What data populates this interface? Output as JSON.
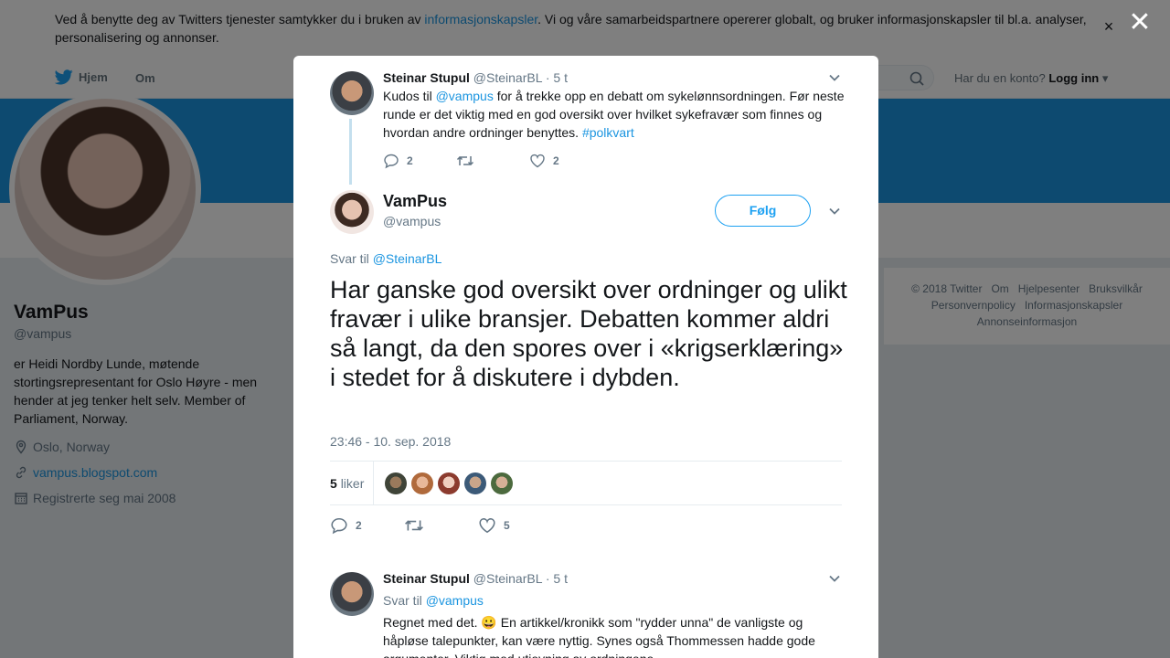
{
  "cookie": {
    "text_before": "Ved å benytte deg av Twitters tjenester samtykker du i bruken av ",
    "link": "informasjonskapsler",
    "text_after": ". Vi og våre samarbeidspartnere opererer globalt, og bruker informasjonskapsler til bl.a. analyser, personalisering og annonser.",
    "close": "×"
  },
  "nav": {
    "home": "Hjem",
    "about": "Om",
    "login_prompt": "Har du en konto?",
    "login": "Logg inn"
  },
  "profile": {
    "name": "VamPus",
    "handle": "@vampus",
    "bio": "er Heidi Nordby Lunde, møtende stortingsrepresentant for Oslo Høyre - men hender at jeg tenker helt selv. Member of Parliament, Norway.",
    "location": "Oslo, Norway",
    "website": "vampus.blogspot.com",
    "joined": "Registrerte seg mai 2008"
  },
  "footer": [
    "© 2018 Twitter",
    "Om",
    "Hjelpesenter",
    "Bruksvilkår",
    "Personvernpolicy",
    "Informasjonskapsler",
    "Annonseinformasjon"
  ],
  "overlay_close": "✕",
  "parent_tweet": {
    "name": "Steinar Stupul",
    "handle": "@SteinarBL",
    "time": "· 5 t",
    "text_1": "Kudos til ",
    "mention": "@vampus",
    "text_2": " for å trekke opp en debatt om sykelønnsordningen. Før neste runde er det viktig med en god oversikt over hvilket sykefravær som finnes og hvordan andre ordninger benyttes. ",
    "hashtag": "#polkvart",
    "replies": "2",
    "likes": "2"
  },
  "main_tweet": {
    "name": "VamPus",
    "handle": "@vampus",
    "follow": "Følg",
    "reply_prefix": "Svar til ",
    "reply_to": "@SteinarBL",
    "text": "Har ganske god oversikt over ordninger og ulikt fravær i ulike bransjer. Debatten kommer aldri så langt, da den spores over i «krigserklæring» i stedet for å diskutere i dybden.",
    "timestamp": "23:46 - 10. sep. 2018",
    "likes_count": "5",
    "likes_label": "liker",
    "replies": "2",
    "likes": "5"
  },
  "reply_tweet": {
    "name": "Steinar Stupul",
    "handle": "@SteinarBL",
    "time": "· 5 t",
    "reply_prefix": "Svar til ",
    "reply_to": "@vampus",
    "text_1": "Regnet med det. ",
    "emoji": "😀",
    "text_2": " En artikkel/kronikk som \"rydder unna\" de vanligste og håpløse talepunkter, kan være nyttig. Synes også Thommessen hadde gode argumenter. Viktig med utjevning av ordningene."
  },
  "colors": {
    "accent": "#1da1f2",
    "link": "#1b95e0",
    "banner": "#1b95e0"
  }
}
